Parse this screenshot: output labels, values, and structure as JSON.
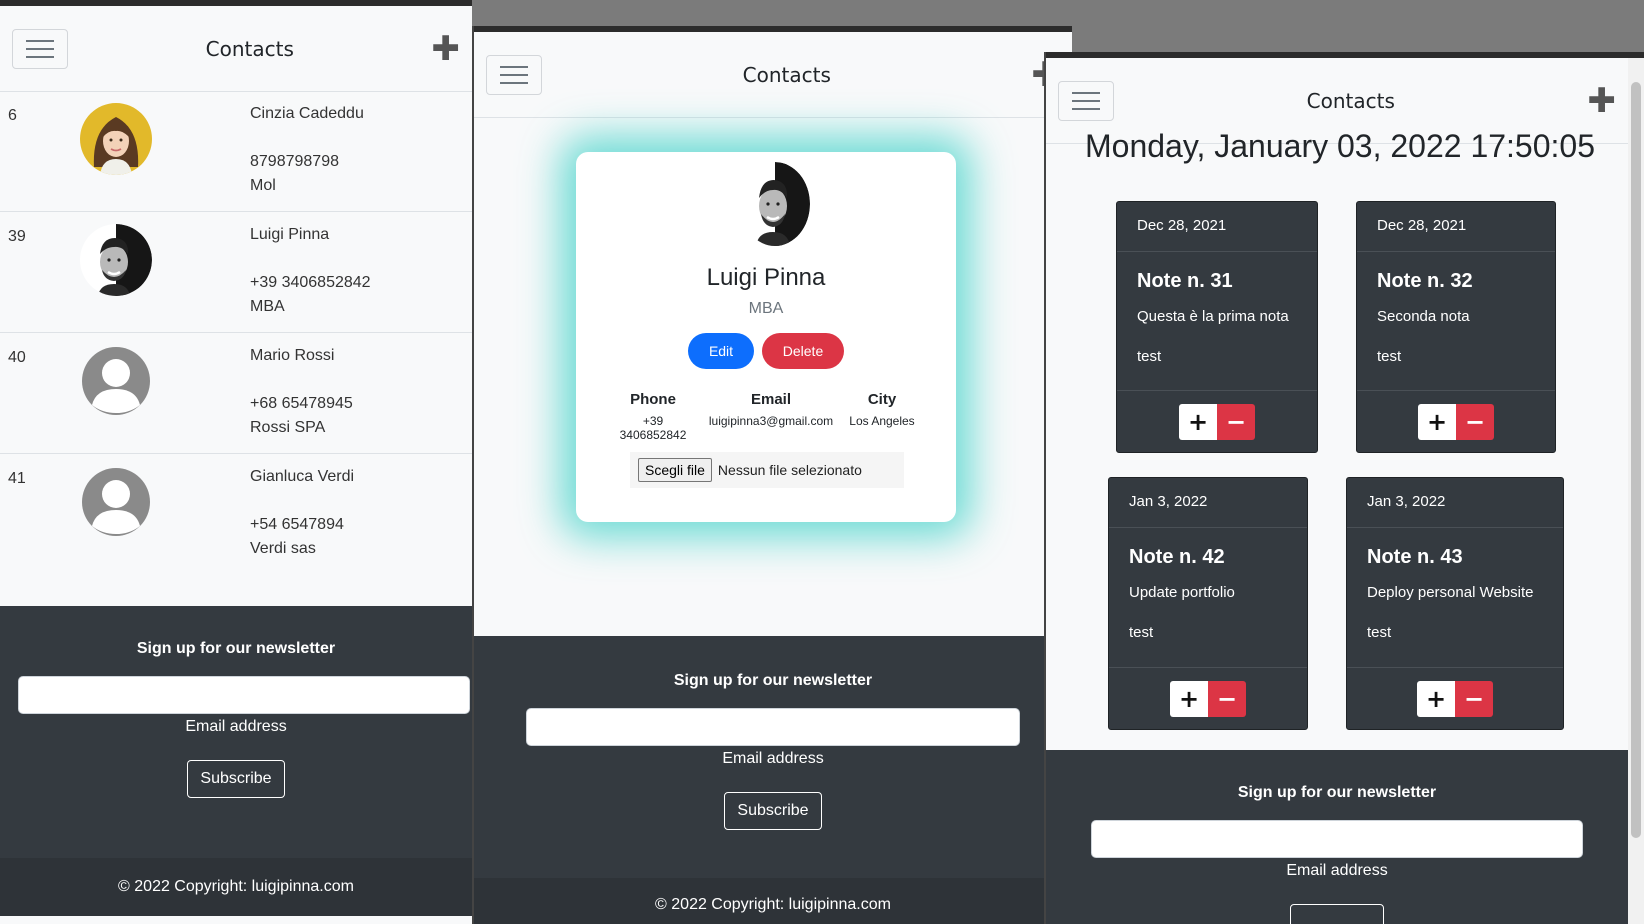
{
  "app": {
    "title": "Contacts"
  },
  "contacts": [
    {
      "id": "6",
      "name": "Cinzia Cadeddu",
      "phone": "8798798798",
      "company": "Mol",
      "avatar": "woman-photo"
    },
    {
      "id": "39",
      "name": "Luigi Pinna",
      "phone": "+39 3406852842",
      "company": "MBA",
      "avatar": "man-photo"
    },
    {
      "id": "40",
      "name": "Mario Rossi",
      "phone": "+68 65478945",
      "company": "Rossi SPA",
      "avatar": "default-avatar"
    },
    {
      "id": "41",
      "name": "Gianluca Verdi",
      "phone": "+54 6547894",
      "company": "Verdi sas",
      "avatar": "default-avatar"
    }
  ],
  "profile": {
    "name": "Luigi Pinna",
    "company": "MBA",
    "edit_label": "Edit",
    "delete_label": "Delete",
    "phone_label": "Phone",
    "phone": "+39 3406852842",
    "email_label": "Email",
    "email": "luigipinna3@gmail.com",
    "city_label": "City",
    "city": "Los Angeles",
    "file_button": "Scegli file",
    "file_status": "Nessun file selezionato"
  },
  "notes_page": {
    "datetime": "Monday, January 03, 2022 17:50:05",
    "notes": [
      {
        "date": "Dec 28, 2021",
        "title": "Note n. 31",
        "body": "Questa è la prima nota",
        "tag": "test"
      },
      {
        "date": "Dec 28, 2021",
        "title": "Note n. 32",
        "body": "Seconda nota",
        "tag": "test"
      },
      {
        "date": "Jan 3, 2022",
        "title": "Note n. 42",
        "body": "Update portfolio",
        "tag": "test"
      },
      {
        "date": "Jan 3, 2022",
        "title": "Note n. 43",
        "body": "Deploy personal Website",
        "tag": "test"
      }
    ],
    "plus_label": "+",
    "minus_label": "−"
  },
  "footer": {
    "newsletter_title": "Sign up for our newsletter",
    "email_label": "Email address",
    "subscribe_label": "Subscribe",
    "copyright": "© 2022 Copyright: luigipinna.com"
  },
  "colors": {
    "primary": "#0d6efd",
    "danger": "#dc3545",
    "dark": "#343a40",
    "glow": "#40d2c8"
  }
}
